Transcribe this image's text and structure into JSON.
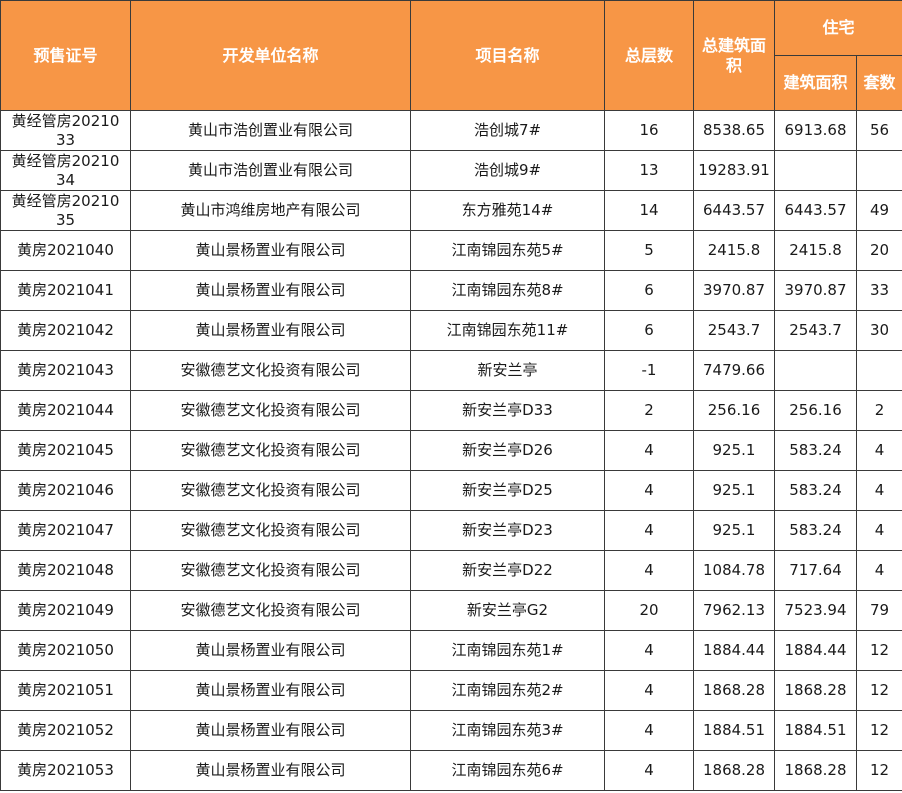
{
  "headers": {
    "permit_no": "预售证号",
    "developer": "开发单位名称",
    "project": "项目名称",
    "floors": "总层数",
    "total_area": "总建筑面积",
    "residential": "住宅",
    "res_area": "建筑面积",
    "res_units": "套数"
  },
  "rows": [
    {
      "permit": "黄经管房2021033",
      "developer": "黄山市浩创置业有限公司",
      "project": "浩创城7#",
      "floors": "16",
      "total_area": "8538.65",
      "res_area": "6913.68",
      "units": "56"
    },
    {
      "permit": "黄经管房2021034",
      "developer": "黄山市浩创置业有限公司",
      "project": "浩创城9#",
      "floors": "13",
      "total_area": "19283.91",
      "res_area": "",
      "units": ""
    },
    {
      "permit": "黄经管房2021035",
      "developer": "黄山市鸿维房地产有限公司",
      "project": "东方雅苑14#",
      "floors": "14",
      "total_area": "6443.57",
      "res_area": "6443.57",
      "units": "49"
    },
    {
      "permit": "黄房2021040",
      "developer": "黄山景杨置业有限公司",
      "project": "江南锦园东苑5#",
      "floors": "5",
      "total_area": "2415.8",
      "res_area": "2415.8",
      "units": "20"
    },
    {
      "permit": "黄房2021041",
      "developer": "黄山景杨置业有限公司",
      "project": "江南锦园东苑8#",
      "floors": "6",
      "total_area": "3970.87",
      "res_area": "3970.87",
      "units": "33"
    },
    {
      "permit": "黄房2021042",
      "developer": "黄山景杨置业有限公司",
      "project": "江南锦园东苑11#",
      "floors": "6",
      "total_area": "2543.7",
      "res_area": "2543.7",
      "units": "30"
    },
    {
      "permit": "黄房2021043",
      "developer": "安徽德艺文化投资有限公司",
      "project": "新安兰亭",
      "floors": "-1",
      "total_area": "7479.66",
      "res_area": "",
      "units": ""
    },
    {
      "permit": "黄房2021044",
      "developer": "安徽德艺文化投资有限公司",
      "project": "新安兰亭D33",
      "floors": "2",
      "total_area": "256.16",
      "res_area": "256.16",
      "units": "2"
    },
    {
      "permit": "黄房2021045",
      "developer": "安徽德艺文化投资有限公司",
      "project": "新安兰亭D26",
      "floors": "4",
      "total_area": "925.1",
      "res_area": "583.24",
      "units": "4"
    },
    {
      "permit": "黄房2021046",
      "developer": "安徽德艺文化投资有限公司",
      "project": "新安兰亭D25",
      "floors": "4",
      "total_area": "925.1",
      "res_area": "583.24",
      "units": "4"
    },
    {
      "permit": "黄房2021047",
      "developer": "安徽德艺文化投资有限公司",
      "project": "新安兰亭D23",
      "floors": "4",
      "total_area": "925.1",
      "res_area": "583.24",
      "units": "4"
    },
    {
      "permit": "黄房2021048",
      "developer": "安徽德艺文化投资有限公司",
      "project": "新安兰亭D22",
      "floors": "4",
      "total_area": "1084.78",
      "res_area": "717.64",
      "units": "4"
    },
    {
      "permit": "黄房2021049",
      "developer": "安徽德艺文化投资有限公司",
      "project": "新安兰亭G2",
      "floors": "20",
      "total_area": "7962.13",
      "res_area": "7523.94",
      "units": "79"
    },
    {
      "permit": "黄房2021050",
      "developer": "黄山景杨置业有限公司",
      "project": "江南锦园东苑1#",
      "floors": "4",
      "total_area": "1884.44",
      "res_area": "1884.44",
      "units": "12"
    },
    {
      "permit": "黄房2021051",
      "developer": "黄山景杨置业有限公司",
      "project": "江南锦园东苑2#",
      "floors": "4",
      "total_area": "1868.28",
      "res_area": "1868.28",
      "units": "12"
    },
    {
      "permit": "黄房2021052",
      "developer": "黄山景杨置业有限公司",
      "project": "江南锦园东苑3#",
      "floors": "4",
      "total_area": "1884.51",
      "res_area": "1884.51",
      "units": "12"
    },
    {
      "permit": "黄房2021053",
      "developer": "黄山景杨置业有限公司",
      "project": "江南锦园东苑6#",
      "floors": "4",
      "total_area": "1868.28",
      "res_area": "1868.28",
      "units": "12"
    }
  ]
}
